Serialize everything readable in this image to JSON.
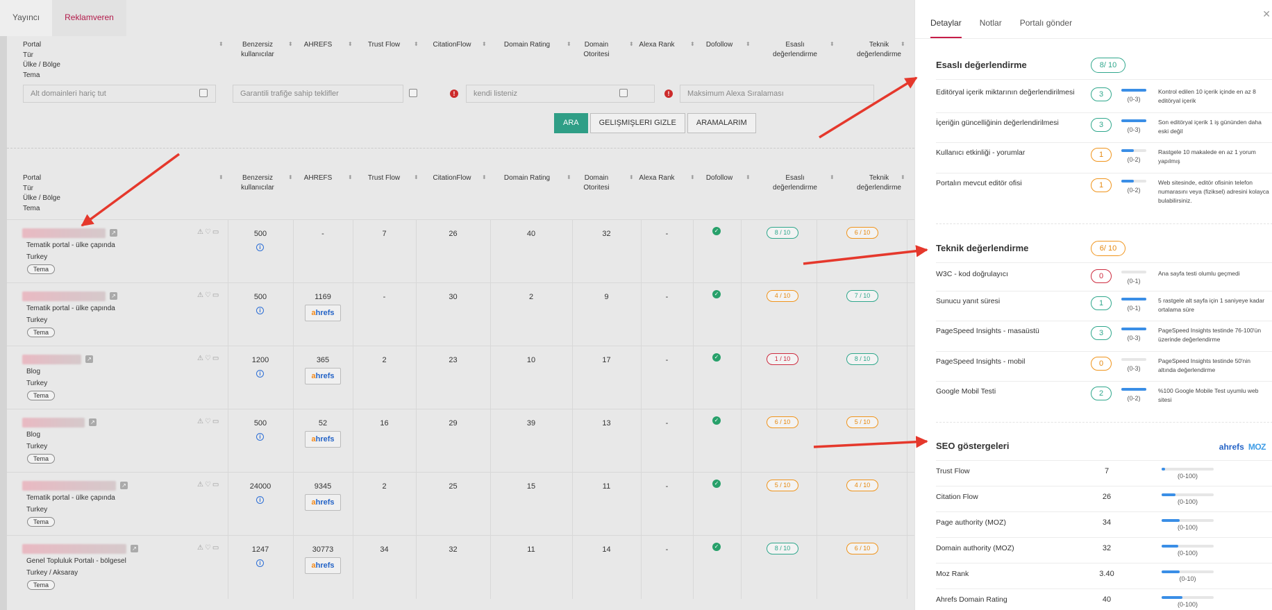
{
  "top_tabs": [
    "Yayıncı",
    "Reklamveren"
  ],
  "columns": {
    "portal": [
      "Portal",
      "Tür",
      "Ülke / Bölge",
      "Tema"
    ],
    "unique_users": [
      "Benzersiz",
      "kullanıcılar"
    ],
    "ahrefs": "AHREFS",
    "trust_flow": "Trust Flow",
    "citation_flow": "CitationFlow",
    "domain_rating": "Domain Rating",
    "domain_authority": [
      "Domain",
      "Otoritesi"
    ],
    "alexa_rank": "Alexa Rank",
    "dofollow": "Dofollow",
    "esasli": [
      "Esaslı",
      "değerlendirme"
    ],
    "teknik": [
      "Teknik",
      "değerlendirme"
    ]
  },
  "filters": {
    "subdomains": "Alt domainleri hariç tut",
    "traffic": "Garantili trafiğe sahip teklifler",
    "own_list": "kendi listeniz",
    "max_alexa": "Maksimum Alexa Sıralaması"
  },
  "buttons": {
    "search": "ARA",
    "hide_advanced": "GELIŞMIŞLERI GIZLE",
    "my_searches": "ARAMALARIM"
  },
  "tema_label": "Tema",
  "rows": [
    {
      "type": "Tematik portal - ülke çapında",
      "country": "Turkey",
      "users": "500",
      "ahrefs": "-",
      "show_ahrefs": false,
      "tf": "7",
      "cf": "26",
      "dr": "40",
      "da": "32",
      "alexa": "-",
      "esasli": "8 / 10",
      "esasli_c": "g",
      "teknik": "6 / 10",
      "teknik_c": "o"
    },
    {
      "type": "Tematik portal - ülke çapında",
      "country": "Turkey",
      "users": "500",
      "ahrefs": "1169",
      "show_ahrefs": true,
      "tf": "-",
      "cf": "30",
      "dr": "2",
      "da": "9",
      "alexa": "-",
      "esasli": "4 / 10",
      "esasli_c": "o",
      "teknik": "7 / 10",
      "teknik_c": "g"
    },
    {
      "type": "Blog",
      "country": "Turkey",
      "users": "1200",
      "ahrefs": "365",
      "show_ahrefs": true,
      "tf": "2",
      "cf": "23",
      "dr": "10",
      "da": "17",
      "alexa": "-",
      "esasli": "1 / 10",
      "esasli_c": "r",
      "teknik": "8 / 10",
      "teknik_c": "g"
    },
    {
      "type": "Blog",
      "country": "Turkey",
      "users": "500",
      "ahrefs": "52",
      "show_ahrefs": true,
      "tf": "16",
      "cf": "29",
      "dr": "39",
      "da": "13",
      "alexa": "-",
      "esasli": "6 / 10",
      "esasli_c": "o",
      "teknik": "5 / 10",
      "teknik_c": "o"
    },
    {
      "type": "Tematik portal - ülke çapında",
      "country": "Turkey",
      "users": "24000",
      "ahrefs": "9345",
      "show_ahrefs": true,
      "tf": "2",
      "cf": "25",
      "dr": "15",
      "da": "11",
      "alexa": "-",
      "esasli": "5 / 10",
      "esasli_c": "o",
      "teknik": "4 / 10",
      "teknik_c": "o"
    },
    {
      "type": "Genel Topluluk Portalı - bölgesel",
      "country": "Turkey / Aksaray",
      "users": "1247",
      "ahrefs": "30773",
      "show_ahrefs": true,
      "tf": "34",
      "cf": "32",
      "dr": "11",
      "da": "14",
      "alexa": "-",
      "esasli": "8 / 10",
      "esasli_c": "g",
      "teknik": "6 / 10",
      "teknik_c": "o"
    }
  ],
  "panel": {
    "tabs": [
      "Detaylar",
      "Notlar",
      "Portalı gönder"
    ],
    "esasli": {
      "title": "Esaslı değerlendirme",
      "score": "8/ 10",
      "items": [
        {
          "label": "Editöryal içerik miktarının değerlendirilmesi",
          "score": "3",
          "c": "g",
          "fill": 1.0,
          "range": "(0-3)",
          "desc": "Kontrol edilen 10 içerik içinde en az 8 editöryal içerik"
        },
        {
          "label": "İçeriğin güncelliğinin değerlendirilmesi",
          "score": "3",
          "c": "g",
          "fill": 1.0,
          "range": "(0-3)",
          "desc": "Son editöryal içerik 1 iş gününden daha eski değil"
        },
        {
          "label": "Kullanıcı etkinliği - yorumlar",
          "score": "1",
          "c": "o",
          "fill": 0.5,
          "range": "(0-2)",
          "desc": "Rastgele 10 makalede en az 1 yorum yapılmış"
        },
        {
          "label": "Portalın mevcut editör ofisi",
          "score": "1",
          "c": "o",
          "fill": 0.5,
          "range": "(0-2)",
          "desc": "Web sitesinde, editör ofisinin telefon numarasını veya (fiziksel) adresini kolayca bulabilirsiniz."
        }
      ]
    },
    "teknik": {
      "title": "Teknik değerlendirme",
      "score": "6/ 10",
      "items": [
        {
          "label": "W3C - kod doğrulayıcı",
          "score": "0",
          "c": "r",
          "fill": 0,
          "range": "(0-1)",
          "desc": "Ana sayfa testi olumlu geçmedi"
        },
        {
          "label": "Sunucu yanıt süresi",
          "score": "1",
          "c": "g",
          "fill": 1.0,
          "range": "(0-1)",
          "desc": "5 rastgele alt sayfa için 1 saniyeye kadar ortalama süre"
        },
        {
          "label": "PageSpeed Insights - masaüstü",
          "score": "3",
          "c": "g",
          "fill": 1.0,
          "range": "(0-3)",
          "desc": "PageSpeed Insights testinde 76-100'ün üzerinde değerlendirme"
        },
        {
          "label": "PageSpeed Insights - mobil",
          "score": "0",
          "c": "o",
          "fill": 0,
          "range": "(0-3)",
          "desc": "PageSpeed Insights testinde 50'nin altında değerlendirme"
        },
        {
          "label": "Google Mobil Testi",
          "score": "2",
          "c": "g",
          "fill": 1.0,
          "range": "(0-2)",
          "desc": "%100 Google Mobile Test uyumlu web sitesi"
        }
      ]
    },
    "seo": {
      "title": "SEO göstergeleri",
      "logo_ahrefs": "ahrefs",
      "logo_moz": "MOZ",
      "items": [
        {
          "label": "Trust Flow",
          "value": "7",
          "fill": 0.07,
          "range": "(0-100)"
        },
        {
          "label": "Citation Flow",
          "value": "26",
          "fill": 0.26,
          "range": "(0-100)"
        },
        {
          "label": "Page authority (MOZ)",
          "value": "34",
          "fill": 0.34,
          "range": "(0-100)"
        },
        {
          "label": "Domain authority (MOZ)",
          "value": "32",
          "fill": 0.32,
          "range": "(0-100)"
        },
        {
          "label": "Moz Rank",
          "value": "3.40",
          "fill": 0.34,
          "range": "(0-10)"
        },
        {
          "label": "Ahrefs Domain Rating",
          "value": "40",
          "fill": 0.4,
          "range": "(0-100)"
        }
      ]
    }
  },
  "colors": {
    "green": "#2fa78c",
    "orange": "#f0941b",
    "red": "#cd2a3e",
    "brand": "#b21a4a",
    "bar": "#3a8ee6",
    "arrow": "#e5382c"
  }
}
